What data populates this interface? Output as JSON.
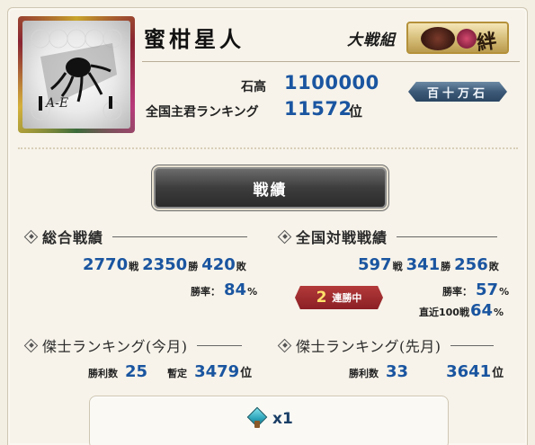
{
  "player": {
    "name": "蜜柑星人",
    "team_label": "大戦組",
    "team_kanji": "絆"
  },
  "stats": {
    "kokudaka_label": "石高",
    "kokudaka_value": "1100000",
    "rank_label": "全国主君ランキング",
    "rank_value": "11572",
    "rank_unit": "位",
    "title_badge": "百十万石"
  },
  "section": {
    "title": "戦績"
  },
  "overall": {
    "heading": "総合戦績",
    "battles": "2770",
    "battles_unit": "戦",
    "wins": "2350",
    "wins_unit": "勝",
    "losses": "420",
    "losses_unit": "敗",
    "winrate_label": "勝率：",
    "winrate": "84",
    "percent": "%"
  },
  "national": {
    "heading": "全国対戦戦績",
    "battles": "597",
    "battles_unit": "戦",
    "wins": "341",
    "wins_unit": "勝",
    "losses": "256",
    "losses_unit": "敗",
    "winrate_label": "勝率：",
    "winrate": "57",
    "percent": "%",
    "recent_label": "直近100戦",
    "recent": "64",
    "streak_count": "2",
    "streak_label": "連勝中"
  },
  "ranking_this_month": {
    "heading": "傑士ランキング(今月)",
    "wins_label": "勝利数",
    "wins": "25",
    "provisional_label": "暫定",
    "rank": "3479",
    "rank_unit": "位"
  },
  "ranking_last_month": {
    "heading": "傑士ランキング(先月)",
    "wins_label": "勝利数",
    "wins": "33",
    "rank": "3641",
    "rank_unit": "位"
  },
  "item": {
    "count": "x1",
    "icon": "gem-icon"
  },
  "colors": {
    "value_blue": "#1a55a0",
    "streak_red": "#8b1f25",
    "header_dark": "#3d3d3d"
  }
}
